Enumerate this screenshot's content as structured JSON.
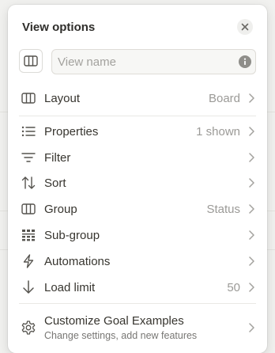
{
  "header": {
    "title": "View options"
  },
  "name_input": {
    "placeholder": "View name",
    "value": ""
  },
  "layout": {
    "label": "Layout",
    "value": "Board"
  },
  "items": [
    {
      "label": "Properties",
      "value": "1 shown",
      "icon": "list-icon"
    },
    {
      "label": "Filter",
      "value": "",
      "icon": "filter-icon"
    },
    {
      "label": "Sort",
      "value": "",
      "icon": "sort-icon"
    },
    {
      "label": "Group",
      "value": "Status",
      "icon": "board-icon"
    },
    {
      "label": "Sub-group",
      "value": "",
      "icon": "subgroup-icon"
    },
    {
      "label": "Automations",
      "value": "",
      "icon": "lightning-icon"
    },
    {
      "label": "Load limit",
      "value": "50",
      "icon": "arrow-down-icon"
    }
  ],
  "customize": {
    "title": "Customize Goal Examples",
    "subtitle": "Change settings, add new features",
    "icon": "gear-icon"
  },
  "colors": {
    "text": "#37352f",
    "muted": "#9b9a97",
    "icon": "#55534e"
  }
}
